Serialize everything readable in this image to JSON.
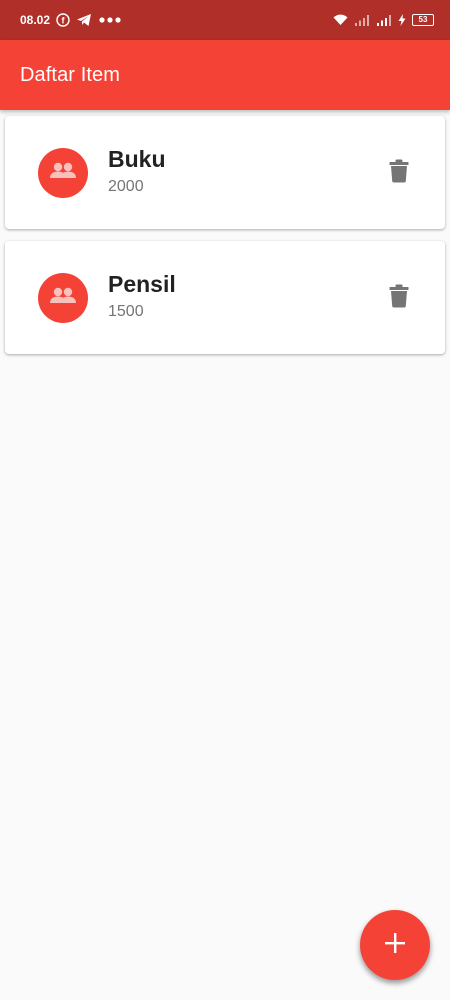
{
  "status_bar": {
    "time": "08.02",
    "battery": "53",
    "icons": [
      "facebook-icon",
      "telegram-icon",
      "more-dots-icon",
      "wifi-icon",
      "signal-icon",
      "signal-icon",
      "charging-icon",
      "battery-icon"
    ]
  },
  "app_bar": {
    "title": "Daftar Item"
  },
  "items": [
    {
      "title": "Buku",
      "subtitle": "2000",
      "icon": "people-icon",
      "action_icon": "trash-icon"
    },
    {
      "title": "Pensil",
      "subtitle": "1500",
      "icon": "people-icon",
      "action_icon": "trash-icon"
    }
  ],
  "fab": {
    "icon": "plus-icon"
  },
  "colors": {
    "primary": "#f44336",
    "status_bar": "#b03029",
    "background": "#fafafa",
    "card": "#ffffff",
    "delete_icon": "#757575"
  }
}
